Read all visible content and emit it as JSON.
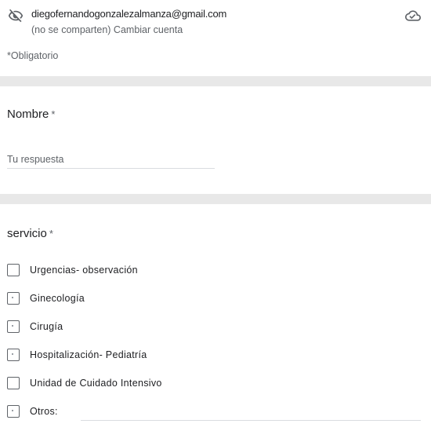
{
  "account": {
    "email": "diegofernandogonzalezalmanza@gmail.com",
    "not_shared": "(no se comparten)",
    "switch_account": "Cambiar cuenta"
  },
  "required_note": "*Obligatorio",
  "question_name": {
    "title": "Nombre",
    "required_mark": "*",
    "placeholder": "Tu respuesta",
    "value": ""
  },
  "question_service": {
    "title": "servicio",
    "required_mark": "*",
    "options": [
      "Urgencias- observación",
      "Ginecología",
      "Cirugía",
      "Hospitalización- Pediatría",
      "Unidad de Cuidado Intensivo",
      "Otros:"
    ],
    "other_value": ""
  },
  "icons": {
    "hidden": "eye-off-icon",
    "cloud": "cloud-done-icon"
  }
}
